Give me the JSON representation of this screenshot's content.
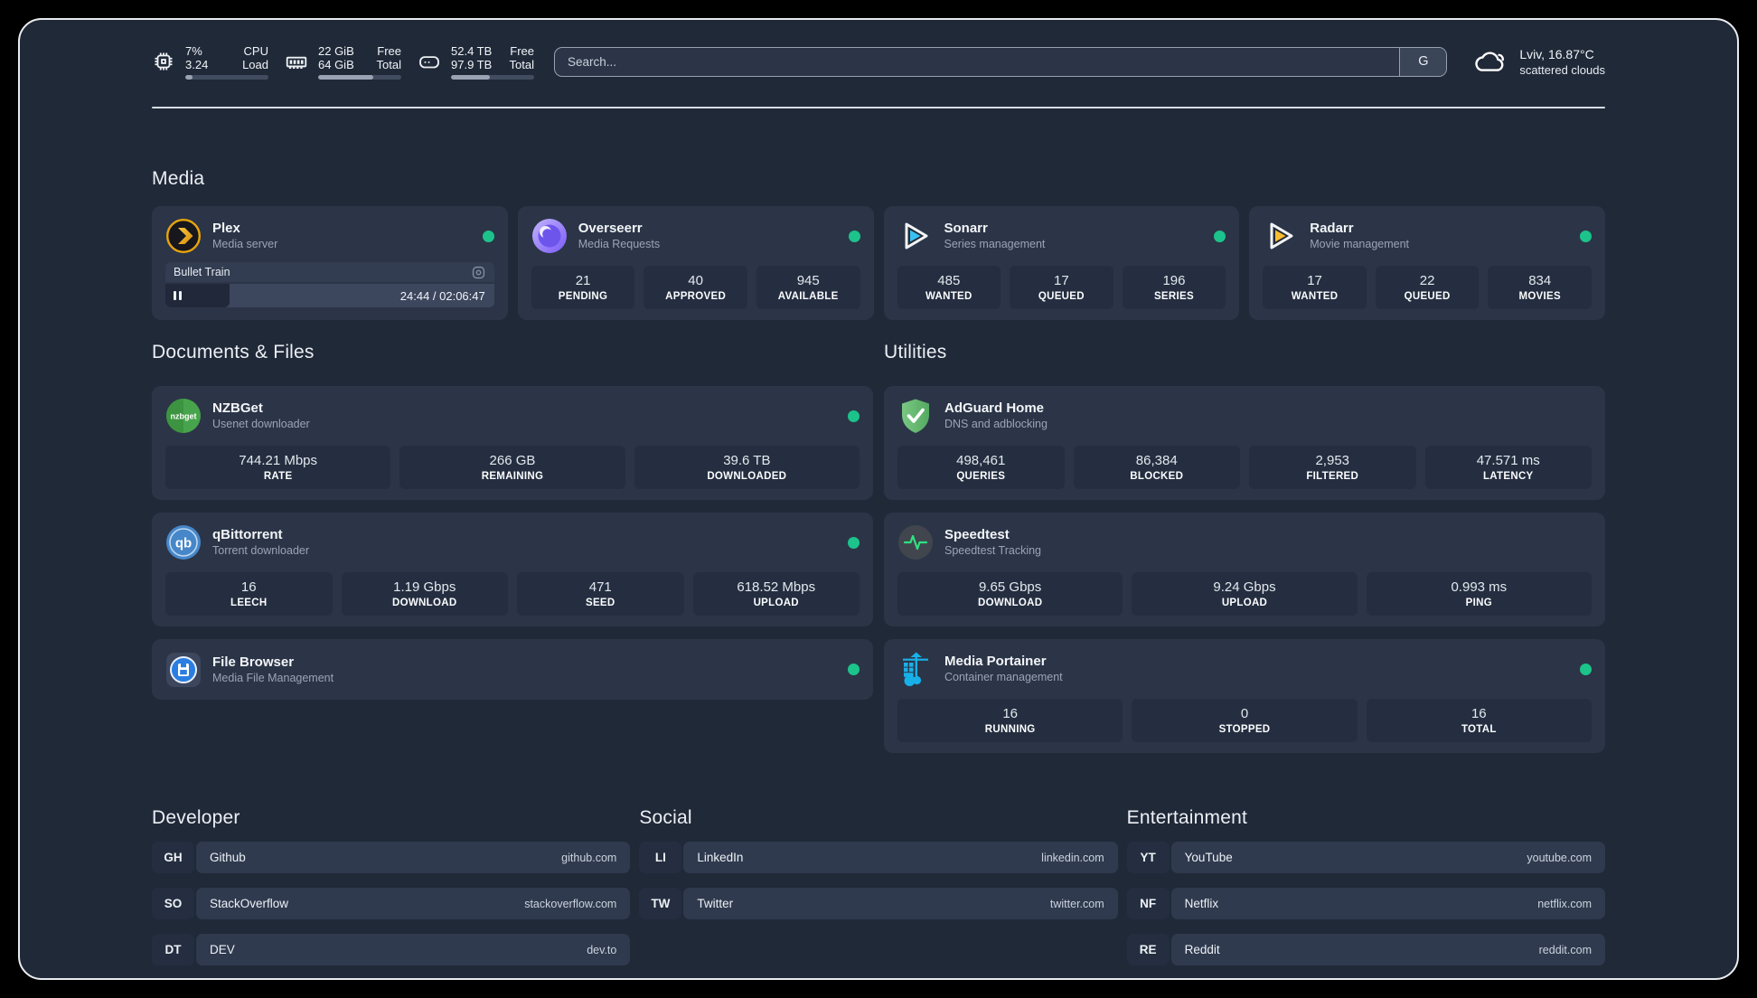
{
  "topbar": {
    "widgets": [
      {
        "name": "cpu",
        "values": [
          "7%",
          "3.24"
        ],
        "labels": [
          "CPU",
          "Load"
        ],
        "progress": 8
      },
      {
        "name": "memory",
        "values": [
          "22 GiB",
          "64 GiB"
        ],
        "labels": [
          "Free",
          "Total"
        ],
        "progress": 66
      },
      {
        "name": "disk",
        "values": [
          "52.4 TB",
          "97.9 TB"
        ],
        "labels": [
          "Free",
          "Total"
        ],
        "progress": 47
      }
    ],
    "search": {
      "placeholder": "Search...",
      "provider": "G"
    },
    "weather": {
      "location_temp": "Lviv, 16.87°C",
      "condition": "scattered clouds"
    }
  },
  "media": {
    "title": "Media",
    "plex": {
      "title": "Plex",
      "subtitle": "Media server",
      "online": true,
      "now_playing": {
        "name": "Bullet Train",
        "time": "24:44 / 02:06:47",
        "progress": 19.5
      }
    },
    "overseerr": {
      "title": "Overseerr",
      "subtitle": "Media Requests",
      "online": true,
      "stats": [
        {
          "value": "21",
          "label": "PENDING"
        },
        {
          "value": "40",
          "label": "APPROVED"
        },
        {
          "value": "945",
          "label": "AVAILABLE"
        }
      ]
    },
    "sonarr": {
      "title": "Sonarr",
      "subtitle": "Series management",
      "online": true,
      "stats": [
        {
          "value": "485",
          "label": "WANTED"
        },
        {
          "value": "17",
          "label": "QUEUED"
        },
        {
          "value": "196",
          "label": "SERIES"
        }
      ]
    },
    "radarr": {
      "title": "Radarr",
      "subtitle": "Movie management",
      "online": true,
      "stats": [
        {
          "value": "17",
          "label": "WANTED"
        },
        {
          "value": "22",
          "label": "QUEUED"
        },
        {
          "value": "834",
          "label": "MOVIES"
        }
      ]
    }
  },
  "documents": {
    "title": "Documents & Files",
    "nzbget": {
      "title": "NZBGet",
      "subtitle": "Usenet downloader",
      "online": true,
      "stats": [
        {
          "value": "744.21 Mbps",
          "label": "RATE"
        },
        {
          "value": "266 GB",
          "label": "REMAINING"
        },
        {
          "value": "39.6 TB",
          "label": "DOWNLOADED"
        }
      ]
    },
    "qbittorrent": {
      "title": "qBittorrent",
      "subtitle": "Torrent downloader",
      "online": true,
      "stats": [
        {
          "value": "16",
          "label": "LEECH"
        },
        {
          "value": "1.19 Gbps",
          "label": "DOWNLOAD"
        },
        {
          "value": "471",
          "label": "SEED"
        },
        {
          "value": "618.52 Mbps",
          "label": "UPLOAD"
        }
      ]
    },
    "filebrowser": {
      "title": "File Browser",
      "subtitle": "Media File Management",
      "online": true
    }
  },
  "utilities": {
    "title": "Utilities",
    "adguard": {
      "title": "AdGuard Home",
      "subtitle": "DNS and adblocking",
      "online": false,
      "stats": [
        {
          "value": "498,461",
          "label": "QUERIES"
        },
        {
          "value": "86,384",
          "label": "BLOCKED"
        },
        {
          "value": "2,953",
          "label": "FILTERED"
        },
        {
          "value": "47.571 ms",
          "label": "LATENCY"
        }
      ]
    },
    "speedtest": {
      "title": "Speedtest",
      "subtitle": "Speedtest Tracking",
      "online": false,
      "stats": [
        {
          "value": "9.65 Gbps",
          "label": "DOWNLOAD"
        },
        {
          "value": "9.24 Gbps",
          "label": "UPLOAD"
        },
        {
          "value": "0.993 ms",
          "label": "PING"
        }
      ]
    },
    "portainer": {
      "title": "Media Portainer",
      "subtitle": "Container management",
      "online": true,
      "stats": [
        {
          "value": "16",
          "label": "RUNNING"
        },
        {
          "value": "0",
          "label": "STOPPED"
        },
        {
          "value": "16",
          "label": "TOTAL"
        }
      ]
    }
  },
  "bookmarks": [
    {
      "title": "Developer",
      "items": [
        {
          "abbr": "GH",
          "name": "Github",
          "url": "github.com"
        },
        {
          "abbr": "SO",
          "name": "StackOverflow",
          "url": "stackoverflow.com"
        },
        {
          "abbr": "DT",
          "name": "DEV",
          "url": "dev.to"
        }
      ]
    },
    {
      "title": "Social",
      "items": [
        {
          "abbr": "LI",
          "name": "LinkedIn",
          "url": "linkedin.com"
        },
        {
          "abbr": "TW",
          "name": "Twitter",
          "url": "twitter.com"
        }
      ]
    },
    {
      "title": "Entertainment",
      "items": [
        {
          "abbr": "YT",
          "name": "YouTube",
          "url": "youtube.com"
        },
        {
          "abbr": "NF",
          "name": "Netflix",
          "url": "netflix.com"
        },
        {
          "abbr": "RE",
          "name": "Reddit",
          "url": "reddit.com"
        }
      ]
    }
  ],
  "colors": {
    "status_online": "#1cc38a",
    "page_bg": "#202938",
    "card_bg": "#2b3547",
    "stat_bg": "#242e40",
    "plex_accent": "#e5a00d",
    "overseerr_accent": "#7a5af8",
    "sonarr_accent": "#35c5f4",
    "radarr_accent": "#ffc230",
    "nzbget_accent": "#42a147",
    "qbittorrent_accent": "#4787c9",
    "filebrowser_accent": "#2a7de1",
    "adguard_accent": "#67b471",
    "speedtest_accent": "#2fe081",
    "portainer_accent": "#13b5ea"
  }
}
